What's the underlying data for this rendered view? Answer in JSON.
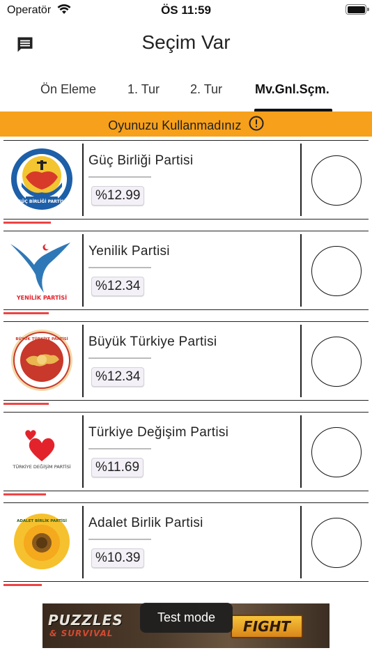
{
  "status_bar": {
    "carrier": "Operatör",
    "time": "ÖS 11:59",
    "wifi_icon": "wifi-icon",
    "battery_icon": "battery-icon"
  },
  "header": {
    "title": "Seçim Var",
    "chat_icon": "chat-icon"
  },
  "tabs": [
    {
      "label": "Ön Eleme",
      "active": false
    },
    {
      "label": "1. Tur",
      "active": false
    },
    {
      "label": "2. Tur",
      "active": false
    },
    {
      "label": "Mv.Gnl.Sçm.",
      "active": true
    }
  ],
  "banner": {
    "text": "Oyunuzu Kullanmadınız",
    "icon": "info-icon",
    "color": "#f7a01b"
  },
  "parties": [
    {
      "name": "Güç Birliği Partisi",
      "percent": "%12.99",
      "logo_text": "GÜÇ BİRLİĞİ PARTİSİ",
      "share": 0.1299
    },
    {
      "name": "Yenilik Partisi",
      "percent": "%12.34",
      "logo_text": "YENİLİK PARTİSİ",
      "share": 0.1234
    },
    {
      "name": "Büyük Türkiye Partisi",
      "percent": "%12.34",
      "logo_text": "BÜYÜK TÜRKİYE PARTİSİ",
      "share": 0.1234
    },
    {
      "name": "Türkiye Değişim Partisi",
      "percent": "%11.69",
      "logo_text": "TÜRKİYE DEĞİŞİM PARTİSİ",
      "share": 0.1169
    },
    {
      "name": "Adalet Birlik Partisi",
      "percent": "%10.39",
      "logo_text": "ADALET BİRLİK PARTİSİ",
      "share": 0.1039
    }
  ],
  "ad": {
    "title": "PUZZLES",
    "subtitle": "& SURVIVAL",
    "button": "FIGHT"
  },
  "toast": "Test mode",
  "colors": {
    "accent": "#f7a01b",
    "bar": "#e44444",
    "line": "#222222"
  }
}
